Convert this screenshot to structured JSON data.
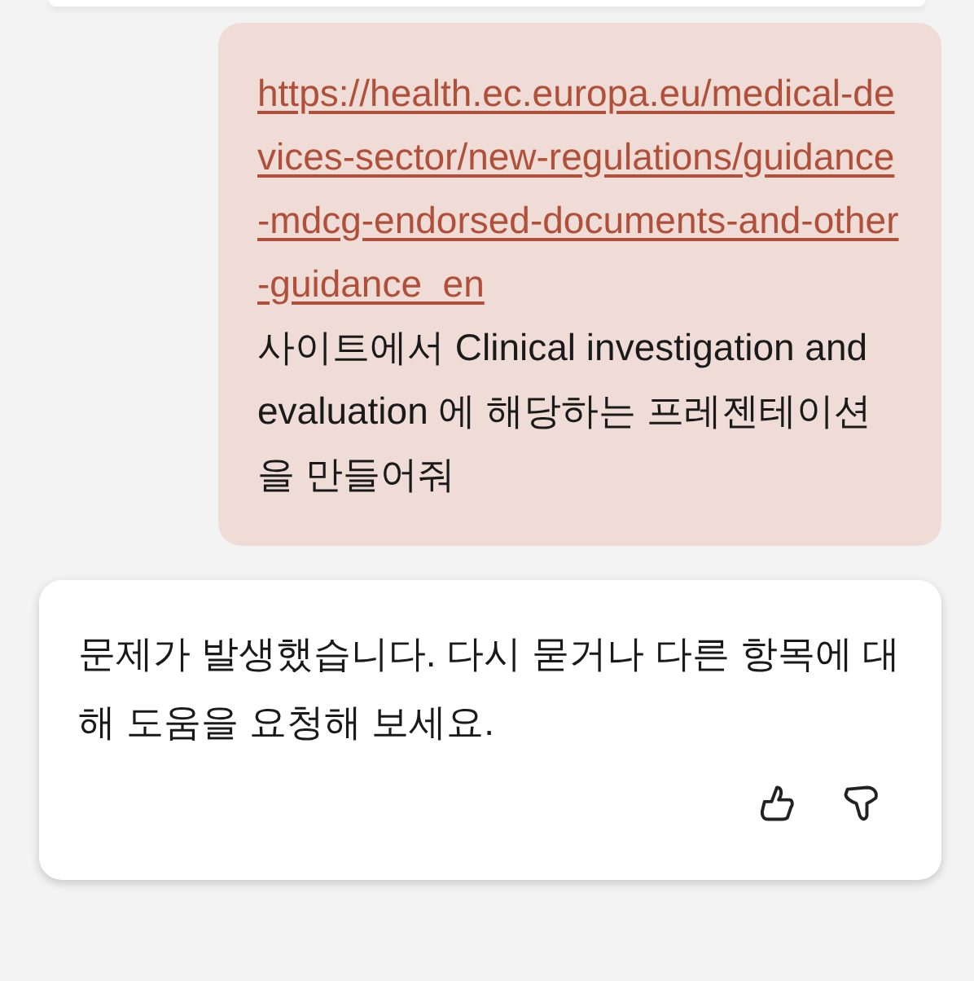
{
  "user_message": {
    "link": "https://health.ec.europa.eu/medical-devices-sector/new-regulations/guidance-mdcg-endorsed-documents-and-other-guidance_en",
    "text": " 사이트에서 Clinical investigation and evaluation 에 해당하는 프레젠테이션을 만들어줘"
  },
  "response": {
    "text": "문제가 발생했습니다. 다시 묻거나 다른 항목에 대해 도움을 요청해 보세요.",
    "actions": [
      {
        "kind": "like"
      },
      {
        "kind": "dislike"
      }
    ]
  }
}
